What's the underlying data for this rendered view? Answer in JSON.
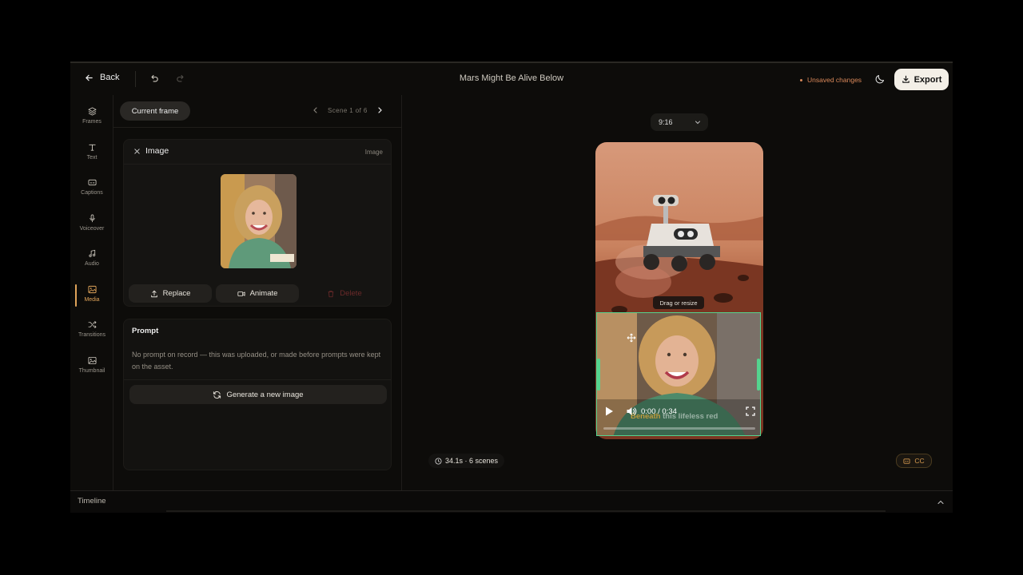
{
  "header": {
    "back_label": "Back",
    "title": "Mars Might Be Alive Below",
    "unsaved_label": "Unsaved changes",
    "export_label": "Export"
  },
  "rail": {
    "items": [
      {
        "label": "Frames",
        "icon": "layers-icon"
      },
      {
        "label": "Text",
        "icon": "text-icon"
      },
      {
        "label": "Captions",
        "icon": "captions-icon"
      },
      {
        "label": "Voiceover",
        "icon": "microphone-icon"
      },
      {
        "label": "Audio",
        "icon": "music-icon"
      },
      {
        "label": "Media",
        "icon": "image-icon",
        "active": true
      },
      {
        "label": "Transitions",
        "icon": "shuffle-icon"
      },
      {
        "label": "Thumbnail",
        "icon": "thumbnail-icon"
      }
    ]
  },
  "panel": {
    "current_frame_label": "Current frame",
    "scene_label": "Scene 1 of 6",
    "image_card": {
      "title": "Image",
      "tag": "Image",
      "replace_label": "Replace",
      "animate_label": "Animate",
      "delete_label": "Delete"
    },
    "prompt_card": {
      "title": "Prompt",
      "text": "No prompt on record — this was uploaded, or made before prompts were kept on the asset.",
      "generate_label": "Generate a new image"
    }
  },
  "stage": {
    "aspect_ratio": "9:16",
    "drag_hint": "Drag or resize",
    "video_time": "0:00 / 0:34",
    "caption_highlight": "Beneath",
    "caption_rest": " this lifeless red",
    "progress": 0,
    "duration_label": "34.1s · 6 scenes",
    "cc_label": "CC"
  },
  "timeline": {
    "label": "Timeline"
  },
  "colors": {
    "accent": "#e0a45a",
    "overlay_border": "#55d38e",
    "unsaved": "#d9885a"
  }
}
